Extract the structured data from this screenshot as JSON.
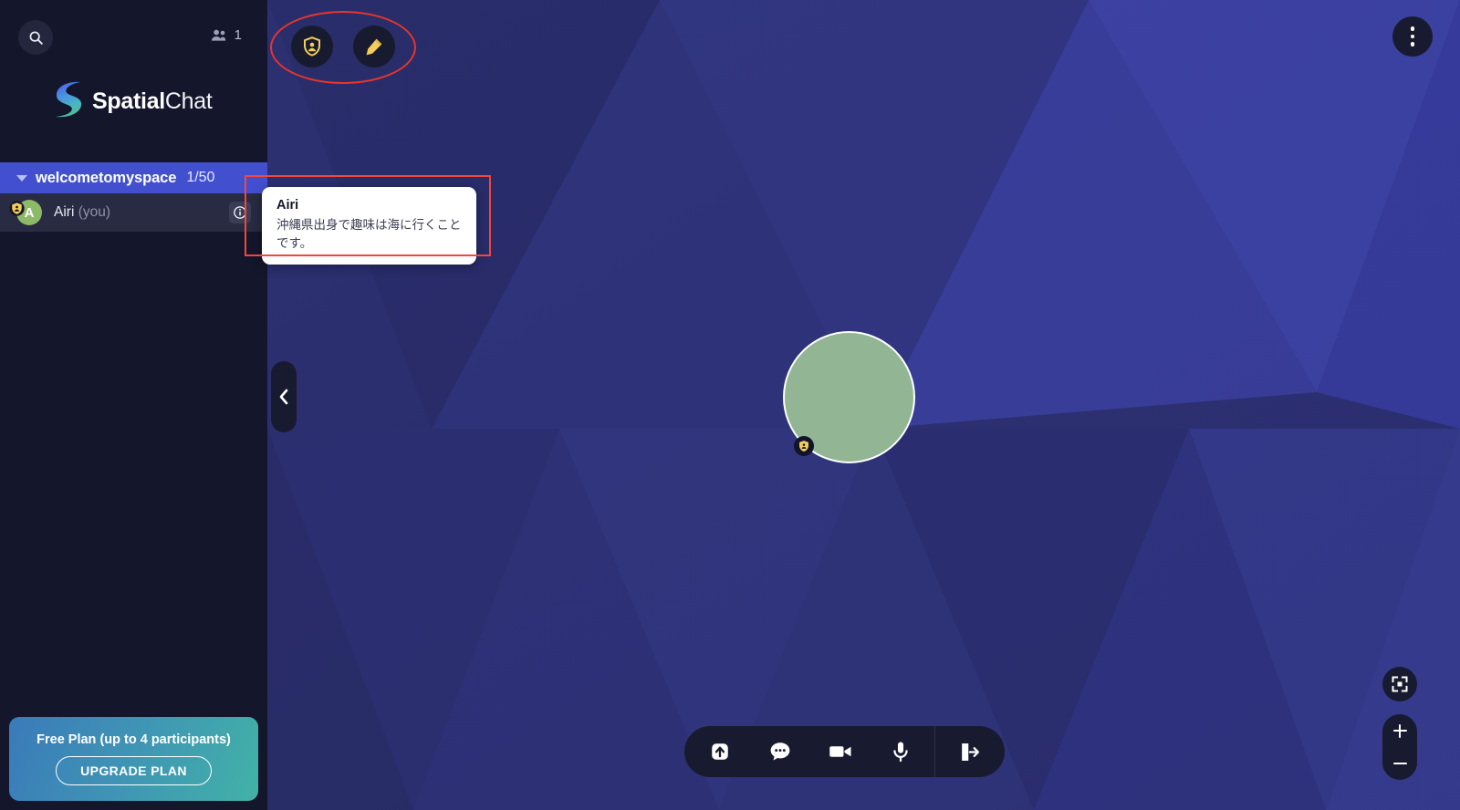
{
  "app": {
    "brand_bold": "Spatial",
    "brand_light": "Chat"
  },
  "sidebar": {
    "search_icon": "search-icon",
    "people_icon": "people-icon",
    "participant_count": "1",
    "space": {
      "name": "welcometomyspace",
      "capacity": "1/50",
      "caret": "chevron-down-icon"
    },
    "participants": [
      {
        "initial": "A",
        "name": "Airi",
        "you_label": "(you)",
        "badge_icon": "shield-person-icon",
        "info_icon": "info-icon",
        "avatar_color": "#8cba66"
      }
    ],
    "plan": {
      "title": "Free Plan (up to 4 participants)",
      "upgrade_label": "UPGRADE PLAN",
      "gradient_from": "#3a7ab8",
      "gradient_to": "#42b2a7"
    }
  },
  "canvas": {
    "background_color": "#2c2f72",
    "top_tools": [
      {
        "name": "moderator-badge-button",
        "icon": "shield-person-icon",
        "color": "#f4ce58"
      },
      {
        "name": "edit-button",
        "icon": "pencil-icon",
        "color": "#f4ce58"
      }
    ],
    "menu_button": {
      "icon": "three-dots-vertical-icon"
    },
    "collapse_button": {
      "icon": "chevron-left-icon"
    },
    "user_bubble": {
      "fill": "#92b593",
      "border": "#ffffff",
      "badge_icon": "shield-person-icon",
      "badge_color": "#f4ce58"
    },
    "bottom_toolbar": [
      {
        "name": "share-screen-button",
        "icon": "share-up-icon"
      },
      {
        "name": "chat-button",
        "icon": "chat-bubble-icon"
      },
      {
        "name": "camera-button",
        "icon": "video-camera-icon"
      },
      {
        "name": "microphone-button",
        "icon": "microphone-icon"
      },
      {
        "name": "leave-button",
        "icon": "exit-door-icon"
      }
    ],
    "viewport_controls": {
      "fit_icon": "fit-to-screen-icon",
      "zoom_in": "+",
      "zoom_out": "−"
    }
  },
  "tooltip": {
    "name": "Airi",
    "description": "沖縄県出身で趣味は海に行くことです。"
  },
  "annotations": {
    "ellipse_color": "#e8352a",
    "rect_color": "#f0483c"
  }
}
